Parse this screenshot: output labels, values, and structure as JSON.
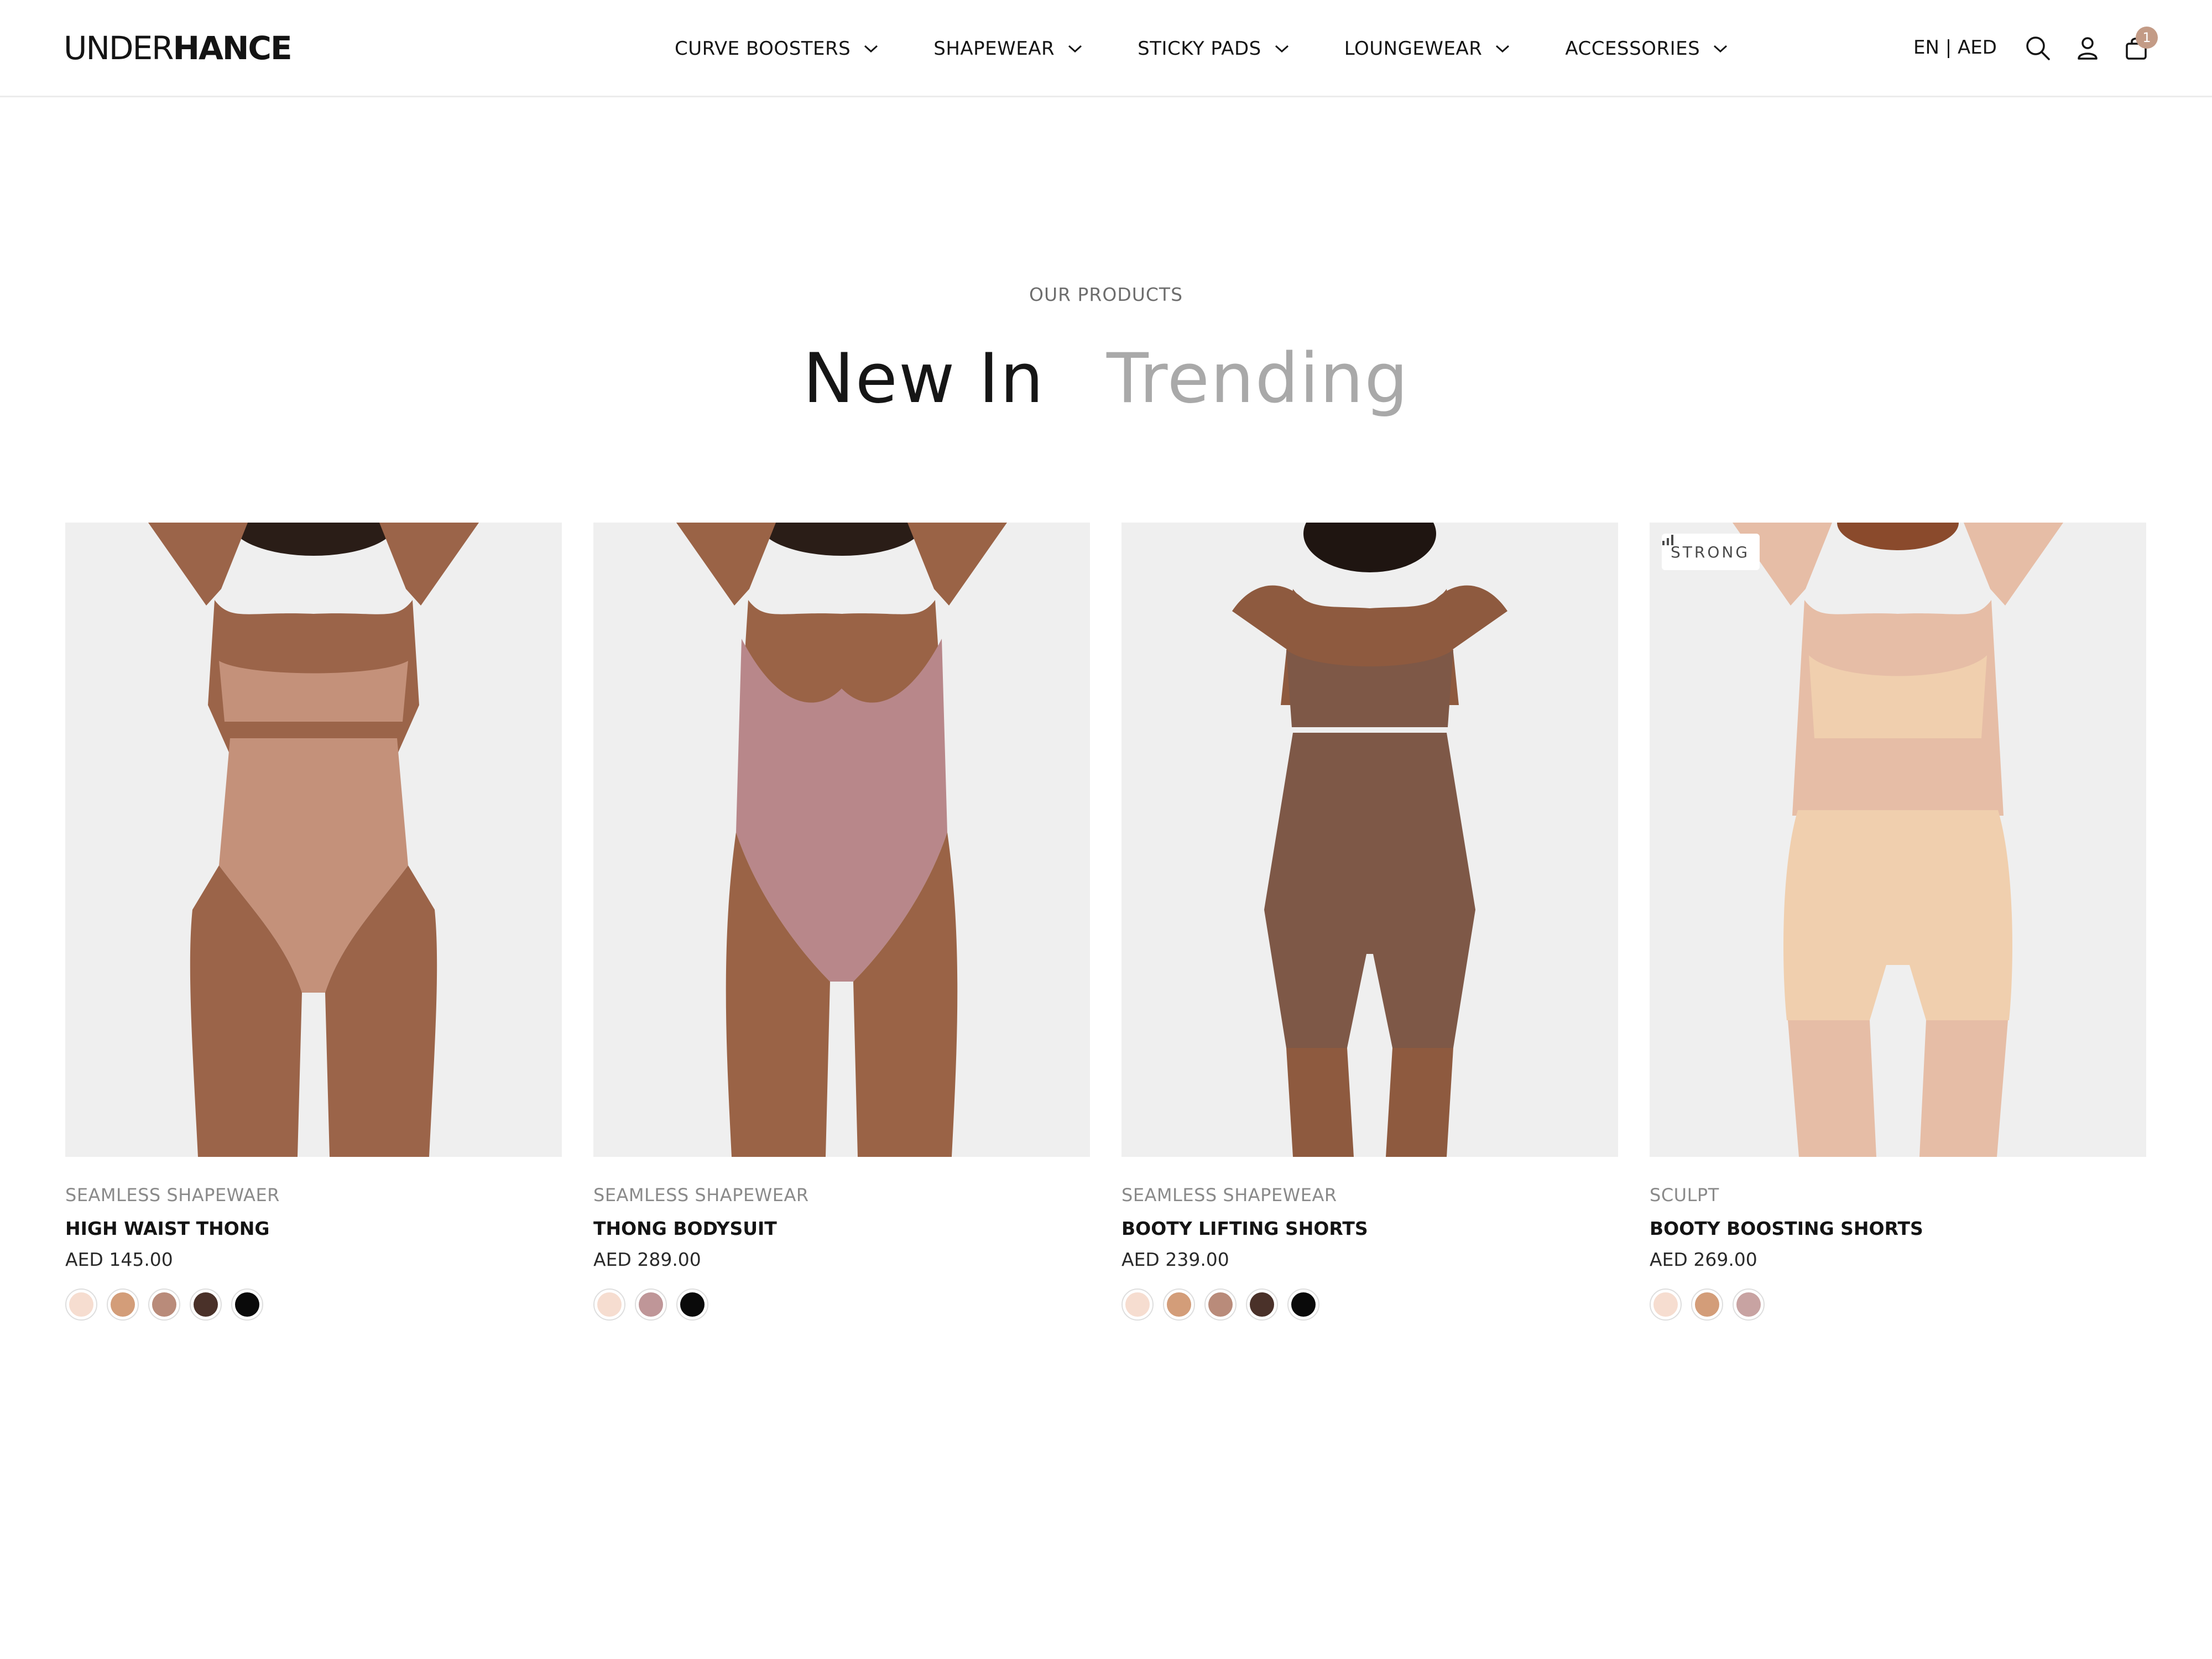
{
  "header": {
    "logo_light": "UNDER",
    "logo_bold": "HANCE",
    "nav": [
      {
        "label": "CURVE BOOSTERS"
      },
      {
        "label": "SHAPEWEAR"
      },
      {
        "label": "STICKY PADS"
      },
      {
        "label": "LOUNGEWEAR"
      },
      {
        "label": "ACCESSORIES"
      }
    ],
    "locale": "EN | AED",
    "cart_count": "1",
    "icons": [
      "search-icon",
      "account-icon",
      "cart-icon",
      "chevron-down-icon"
    ]
  },
  "section": {
    "eyebrow": "OUR PRODUCTS",
    "tabs": [
      {
        "label": "New In",
        "active": true
      },
      {
        "label": "Trending",
        "active": false
      }
    ]
  },
  "products": [
    {
      "category": "SEAMLESS SHAPEWAER",
      "name": "HIGH WAIST THONG",
      "price": "AED 145.00",
      "swatches": [
        "#f6ddd0",
        "#d39d79",
        "#b98b7a",
        "#4a3129",
        "#0a0a0a"
      ],
      "garment_color": "#c4917a",
      "skin_color": "#9b6449"
    },
    {
      "category": "SEAMLESS SHAPEWEAR",
      "name": "THONG BODYSUIT",
      "price": "AED 289.00",
      "swatches": [
        "#f6ddd0",
        "#bf9698",
        "#0a0a0a"
      ],
      "garment_color": "#b8878a",
      "skin_color": "#9a6346"
    },
    {
      "category": "SEAMLESS SHAPEWEAR",
      "name": "BOOTY LIFTING SHORTS",
      "price": "AED 239.00",
      "swatches": [
        "#f6ddd0",
        "#d39d79",
        "#b98b7a",
        "#4a3129",
        "#0a0a0a"
      ],
      "garment_color": "#7e5847",
      "skin_color": "#8e5a3f"
    },
    {
      "category": "SCULPT",
      "name": "BOOTY BOOSTING SHORTS",
      "price": "AED 269.00",
      "badge": "STRONG",
      "swatches": [
        "#f6ddd0",
        "#d39d79",
        "#c8a3a2"
      ],
      "garment_color": "#f0cfae",
      "skin_color": "#e6bda6"
    }
  ]
}
